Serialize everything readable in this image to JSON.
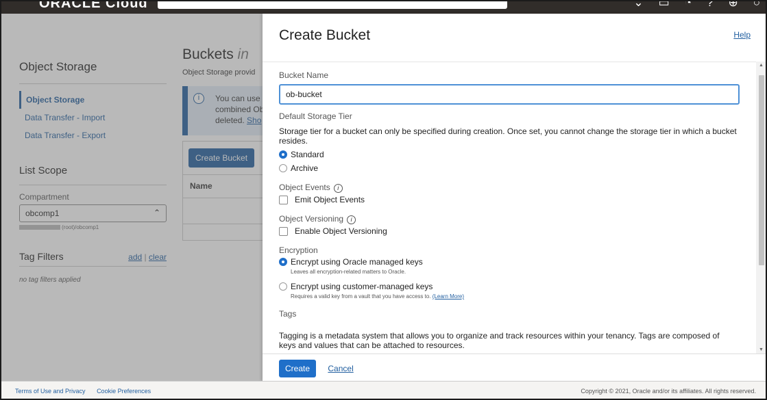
{
  "topbar": {
    "brand": "ORACLE Cloud"
  },
  "sidebar": {
    "title": "Object Storage",
    "items": [
      {
        "label": "Object Storage"
      },
      {
        "label": "Data Transfer - Import"
      },
      {
        "label": "Data Transfer - Export"
      }
    ],
    "scope_title": "List Scope",
    "compartment_label": "Compartment",
    "compartment_value": "obcomp1",
    "compartment_path": "(root)/obcomp1",
    "tag_filters_title": "Tag Filters",
    "add_label": "add",
    "separator": "|",
    "clear_label": "clear",
    "no_tags": "no tag filters applied"
  },
  "main": {
    "title": "Buckets",
    "title_suffix": "in",
    "subtitle": "Object Storage provid",
    "info_line1": "You can use",
    "info_line2": "combined Ob",
    "info_line3": "deleted.",
    "info_link": "Sho",
    "create_bucket_button": "Create Bucket",
    "table_header_name": "Name"
  },
  "panel": {
    "title": "Create Bucket",
    "help": "Help",
    "bucket_name_label": "Bucket Name",
    "bucket_name_value": "ob-bucket",
    "storage_tier_label": "Default Storage Tier",
    "storage_tier_desc": "Storage tier for a bucket can only be specified during creation. Once set, you cannot change the storage tier in which a bucket resides.",
    "tier_standard": "Standard",
    "tier_archive": "Archive",
    "object_events_label": "Object Events",
    "emit_events": "Emit Object Events",
    "object_versioning_label": "Object Versioning",
    "enable_versioning": "Enable Object Versioning",
    "encryption_label": "Encryption",
    "encrypt_oracle": "Encrypt using Oracle managed keys",
    "encrypt_oracle_hint": "Leaves all encryption-related matters to Oracle.",
    "encrypt_customer": "Encrypt using customer-managed keys",
    "encrypt_customer_hint": "Requires a valid key from a vault that you have access to.",
    "learn_more": "(Learn More)",
    "tags_label": "Tags",
    "tags_desc": "Tagging is a metadata system that allows you to organize and track resources within your tenancy. Tags are composed of keys and values that can be attached to resources.",
    "create_button": "Create",
    "cancel_button": "Cancel"
  },
  "footer": {
    "terms": "Terms of Use and Privacy",
    "cookies": "Cookie Preferences",
    "copyright": "Copyright © 2021, Oracle and/or its affiliates. All rights reserved."
  },
  "colors": {
    "accent": "#1f6fc9",
    "link": "#1f5d9f",
    "topbar": "#312d2a"
  }
}
